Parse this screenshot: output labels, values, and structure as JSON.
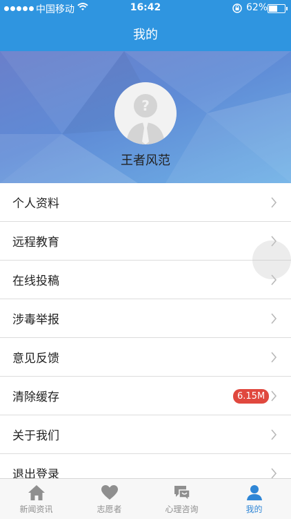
{
  "status_bar": {
    "carrier": "中国移动",
    "time": "16:42",
    "battery_text": "62%",
    "battery_level": 0.62,
    "icons": [
      "signal-icon",
      "wifi-icon",
      "orientation-lock-icon",
      "battery-icon"
    ]
  },
  "nav": {
    "title": "我的"
  },
  "profile": {
    "username": "王者风范",
    "avatar_icon": "default-avatar-icon"
  },
  "menu": {
    "items": [
      {
        "label": "个人资料"
      },
      {
        "label": "远程教育"
      },
      {
        "label": "在线投稿"
      },
      {
        "label": "涉毒举报"
      },
      {
        "label": "意见反馈"
      },
      {
        "label": "清除缓存",
        "badge": "6.15M"
      },
      {
        "label": "关于我们"
      },
      {
        "label": "退出登录"
      }
    ]
  },
  "tabs": [
    {
      "label": "新闻资讯",
      "icon": "home-icon"
    },
    {
      "label": "志愿者",
      "icon": "heart-icon"
    },
    {
      "label": "心理咨询",
      "icon": "chat-icon"
    },
    {
      "label": "我的",
      "icon": "user-icon",
      "active": true
    }
  ],
  "colors": {
    "primary": "#2f95e0",
    "badge": "#e0483e",
    "active_tab": "#2f86d6",
    "inactive_tab": "#8f8f8f"
  }
}
